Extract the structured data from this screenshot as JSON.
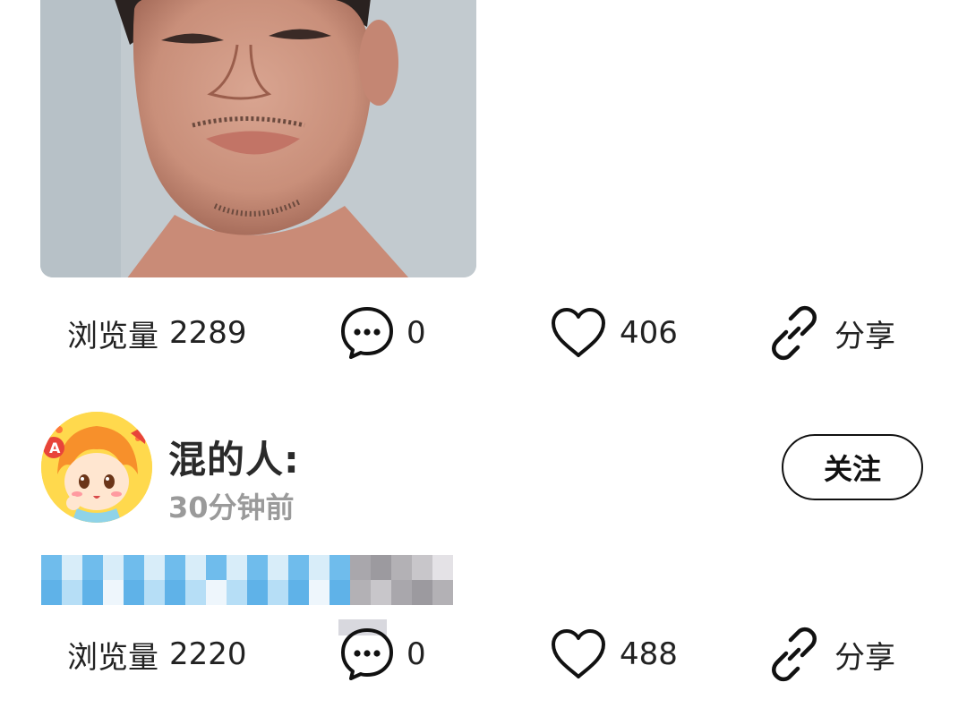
{
  "post1": {
    "views_label": "浏览量",
    "views_count": "2289",
    "comments_count": "0",
    "likes_count": "406",
    "share_label": "分享"
  },
  "post2": {
    "author_name": "混的人:",
    "time_ago": "30分钟前",
    "follow_label": "关注",
    "views_label": "浏览量",
    "views_count": "2220",
    "comments_count": "0",
    "likes_count": "488",
    "share_label": "分享"
  },
  "colors": {
    "text_primary": "#222222",
    "text_secondary": "#9a9a9a",
    "mosaic_blue": "#7ec4ef",
    "mosaic_gray": "#a9a7ac"
  },
  "icons": {
    "comment": "comment-bubble-icon",
    "like": "heart-icon",
    "share": "link-icon"
  }
}
